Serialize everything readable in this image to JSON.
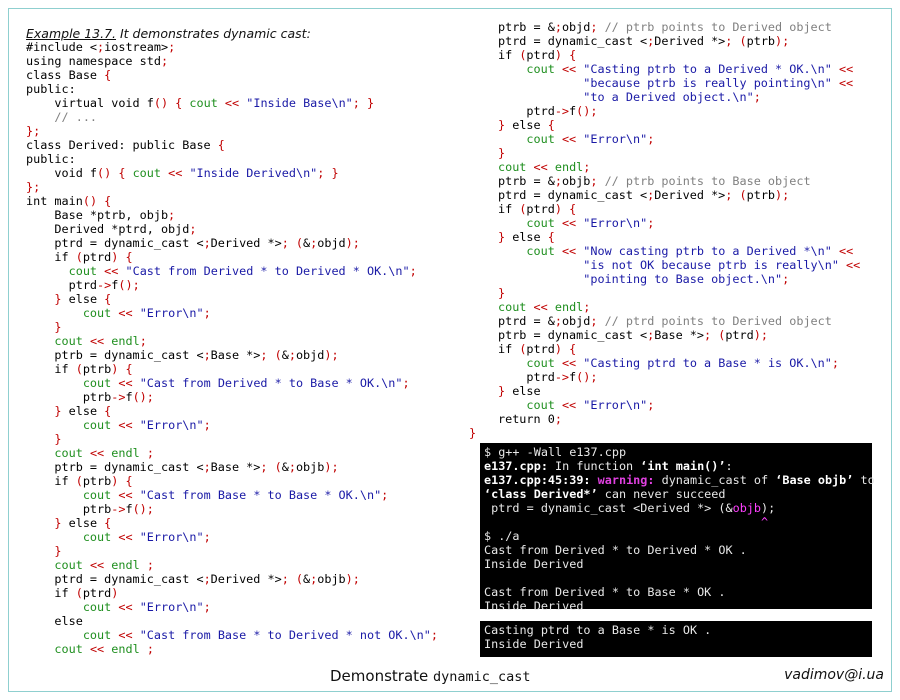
{
  "caption": {
    "example": "Example 13.7.",
    "text": " It demonstrates dynamic cast:"
  },
  "left_code": [
    "#include <iostream>",
    "using namespace std;",
    "class Base {",
    "public:",
    "    virtual void f() { cout << \"Inside Base\\n\"; }",
    "    // ...",
    "};",
    "class Derived: public Base {",
    "public:",
    "    void f() { cout << \"Inside Derived\\n\"; }",
    "};",
    "int main() {",
    "    Base *ptrb, objb;",
    "    Derived *ptrd, objd;",
    "    ptrd = dynamic_cast <Derived *> (&objd);",
    "    if (ptrd) {",
    "      cout << \"Cast from Derived * to Derived * OK.\\n\";",
    "      ptrd->f();",
    "    } else {",
    "        cout << \"Error\\n\";",
    "    }",
    "    cout << endl;",
    "    ptrb = dynamic_cast <Base *> (&objd);",
    "    if (ptrb) {",
    "        cout << \"Cast from Derived * to Base * OK.\\n\";",
    "        ptrb->f();",
    "    } else {",
    "        cout << \"Error\\n\";",
    "    }",
    "    cout << endl ;",
    "    ptrb = dynamic_cast <Base *> (&objb);",
    "    if (ptrb) {",
    "        cout << \"Cast from Base * to Base * OK.\\n\";",
    "        ptrb->f();",
    "    } else {",
    "        cout << \"Error\\n\";",
    "    }",
    "    cout << endl ;",
    "    ptrd = dynamic_cast <Derived *> (&objb);",
    "    if (ptrd)",
    "        cout << \"Error\\n\";",
    "    else",
    "        cout << \"Cast from Base * to Derived * not OK.\\n\";",
    "    cout << endl ;"
  ],
  "right_code": [
    "ptrb = &objd; // ptrb points to Derived object",
    "ptrd = dynamic_cast <Derived *> (ptrb);",
    "if (ptrd) {",
    "    cout << \"Casting ptrb to a Derived * OK.\\n\" <<",
    "            \"because ptrb is really pointing\\n\" <<",
    "            \"to a Derived object.\\n\";",
    "    ptrd->f();",
    "} else {",
    "    cout << \"Error\\n\";",
    "}",
    "cout << endl;",
    "ptrb = &objb; // ptrb points to Base object",
    "ptrd = dynamic_cast <Derived *> (ptrb);",
    "if (ptrd) {",
    "    cout << \"Error\\n\";",
    "} else {",
    "    cout << \"Now casting ptrb to a Derived *\\n\" <<",
    "            \"is not OK because ptrb is really\\n\" <<",
    "            \"pointing to Base object.\\n\";",
    "}",
    "cout << endl;",
    "ptrd = &objd; // ptrd points to Derived object",
    "ptrb = dynamic_cast <Base *> (ptrd);",
    "if (ptrd) {",
    "    cout << \"Casting ptrd to a Base * is OK.\\n\";",
    "    ptrd->f();",
    "} else",
    "    cout << \"Error\\n\";",
    "return 0;"
  ],
  "closing_brace": "}",
  "terminal1": [
    "$ g++ -Wall e137.cpp",
    "e137.cpp: In function ‘int main()’:",
    "e137.cpp:45:39: warning: dynamic_cast of ‘Base objb’ to",
    "‘class Derived*’ can never succeed",
    " ptrd = dynamic_cast <Derived *> (&objb);",
    "                                       ^",
    "$ ./a",
    "Cast from Derived * to Derived * OK .",
    "Inside Derived",
    "",
    "Cast from Derived * to Base * OK .",
    "Inside Derived"
  ],
  "terminal2": [
    "Casting ptrd to a Base * is OK .",
    "Inside Derived"
  ],
  "footer": {
    "title": "Demonstrate ",
    "title_code": "dynamic_cast",
    "author": "vadimov@i.ua"
  }
}
